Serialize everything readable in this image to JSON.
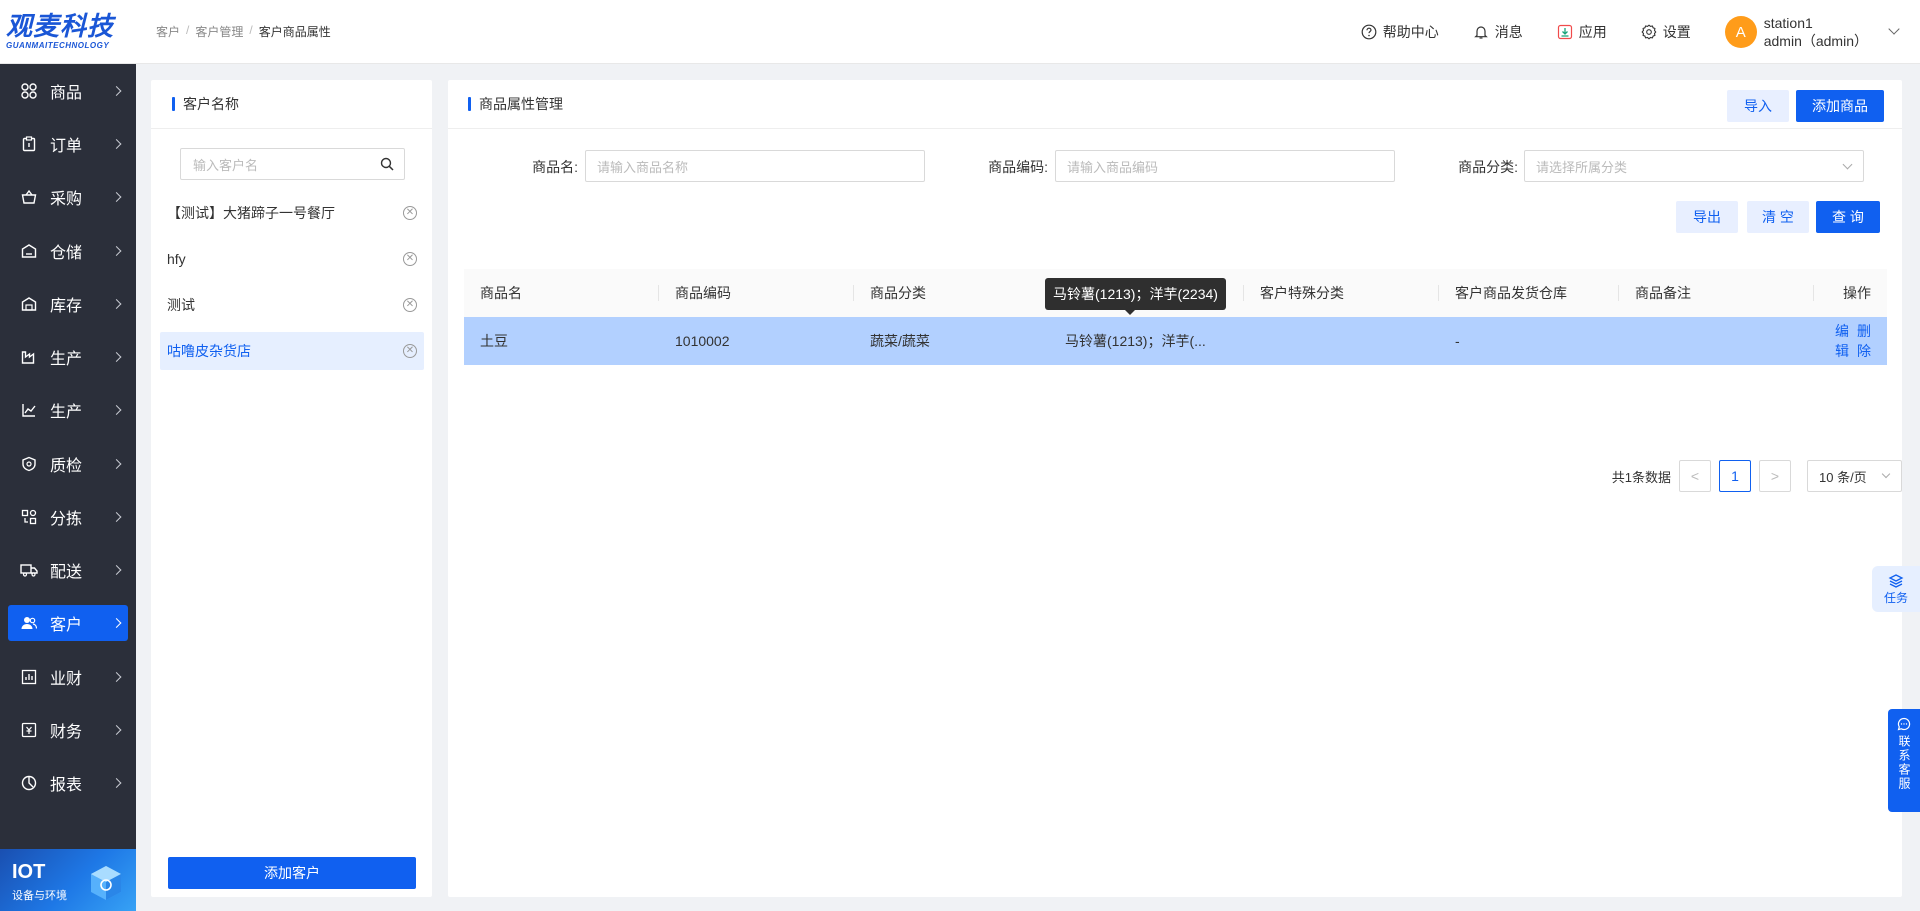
{
  "brand": {
    "logo_text": "观麦科技",
    "logo_sub": "GUANMAITECHNOLOGY"
  },
  "sidebar": {
    "items": [
      {
        "label": "商品",
        "icon": "grid-icon"
      },
      {
        "label": "订单",
        "icon": "clipboard-icon"
      },
      {
        "label": "采购",
        "icon": "basket-icon"
      },
      {
        "label": "仓储",
        "icon": "warehouse-icon"
      },
      {
        "label": "库存",
        "icon": "inventory-icon"
      },
      {
        "label": "生产",
        "icon": "factory-icon"
      },
      {
        "label": "生产",
        "icon": "chart-line-icon"
      },
      {
        "label": "质检",
        "icon": "shield-icon"
      },
      {
        "label": "分拣",
        "icon": "sort-icon"
      },
      {
        "label": "配送",
        "icon": "truck-icon"
      },
      {
        "label": "客户",
        "icon": "users-icon",
        "active": true
      },
      {
        "label": "业财",
        "icon": "bar-chart-icon"
      },
      {
        "label": "财务",
        "icon": "finance-icon"
      },
      {
        "label": "报表",
        "icon": "report-icon"
      }
    ],
    "iot": {
      "title": "IOT",
      "subtitle": "设备与环境"
    }
  },
  "header": {
    "breadcrumb": [
      "客户",
      "客户管理",
      "客户商品属性"
    ],
    "links": [
      {
        "label": "帮助中心",
        "icon": "help-circle-icon"
      },
      {
        "label": "消息",
        "icon": "bell-icon"
      },
      {
        "label": "应用",
        "icon": "app-download-icon"
      },
      {
        "label": "设置",
        "icon": "gear-icon"
      }
    ],
    "user": {
      "avatar_letter": "A",
      "name": "station1",
      "account": "admin（admin）"
    }
  },
  "customer_panel": {
    "title": "客户名称",
    "search_placeholder": "输入客户名",
    "customers": [
      {
        "name": "【测试】大猪蹄子一号餐厅"
      },
      {
        "name": "hfy"
      },
      {
        "name": "测试"
      },
      {
        "name": "咕噜皮杂货店",
        "active": true
      }
    ],
    "add_button": "添加客户"
  },
  "main_panel": {
    "title": "商品属性管理",
    "import_button": "导入",
    "add_button": "添加商品",
    "filters": {
      "name_label": "商品名:",
      "name_placeholder": "请输入商品名称",
      "code_label": "商品编码:",
      "code_placeholder": "请输入商品编码",
      "category_label": "商品分类:",
      "category_placeholder": "请选择所属分类"
    },
    "export_button": "导出",
    "clear_button": "清 空",
    "query_button": "查 询",
    "table": {
      "columns": [
        "商品名",
        "商品编码",
        "商品分类",
        "",
        "客户特殊分类",
        "客户商品发货仓库",
        "商品备注",
        "操作"
      ],
      "rows": [
        {
          "name": "土豆",
          "code": "1010002",
          "category": "蔬菜/蔬菜",
          "alias": "马铃薯(1213)；洋芋(...",
          "special_category": "",
          "warehouse": "-",
          "remark": "",
          "edit": "编辑",
          "delete": "删除"
        }
      ]
    },
    "tooltip": "马铃薯(1213)；洋芋(2234)",
    "pagination": {
      "total": "共1条数据",
      "prev": "<",
      "current": "1",
      "next": ">",
      "page_size": "10 条/页"
    }
  },
  "widgets": {
    "task": "任务",
    "customer_service": "联系客服"
  },
  "colors": {
    "primary": "#1060f0",
    "sidebar_bg": "#2b2f3a",
    "selected_row": "#b2d0ff",
    "avatar": "#ff9c1a"
  }
}
